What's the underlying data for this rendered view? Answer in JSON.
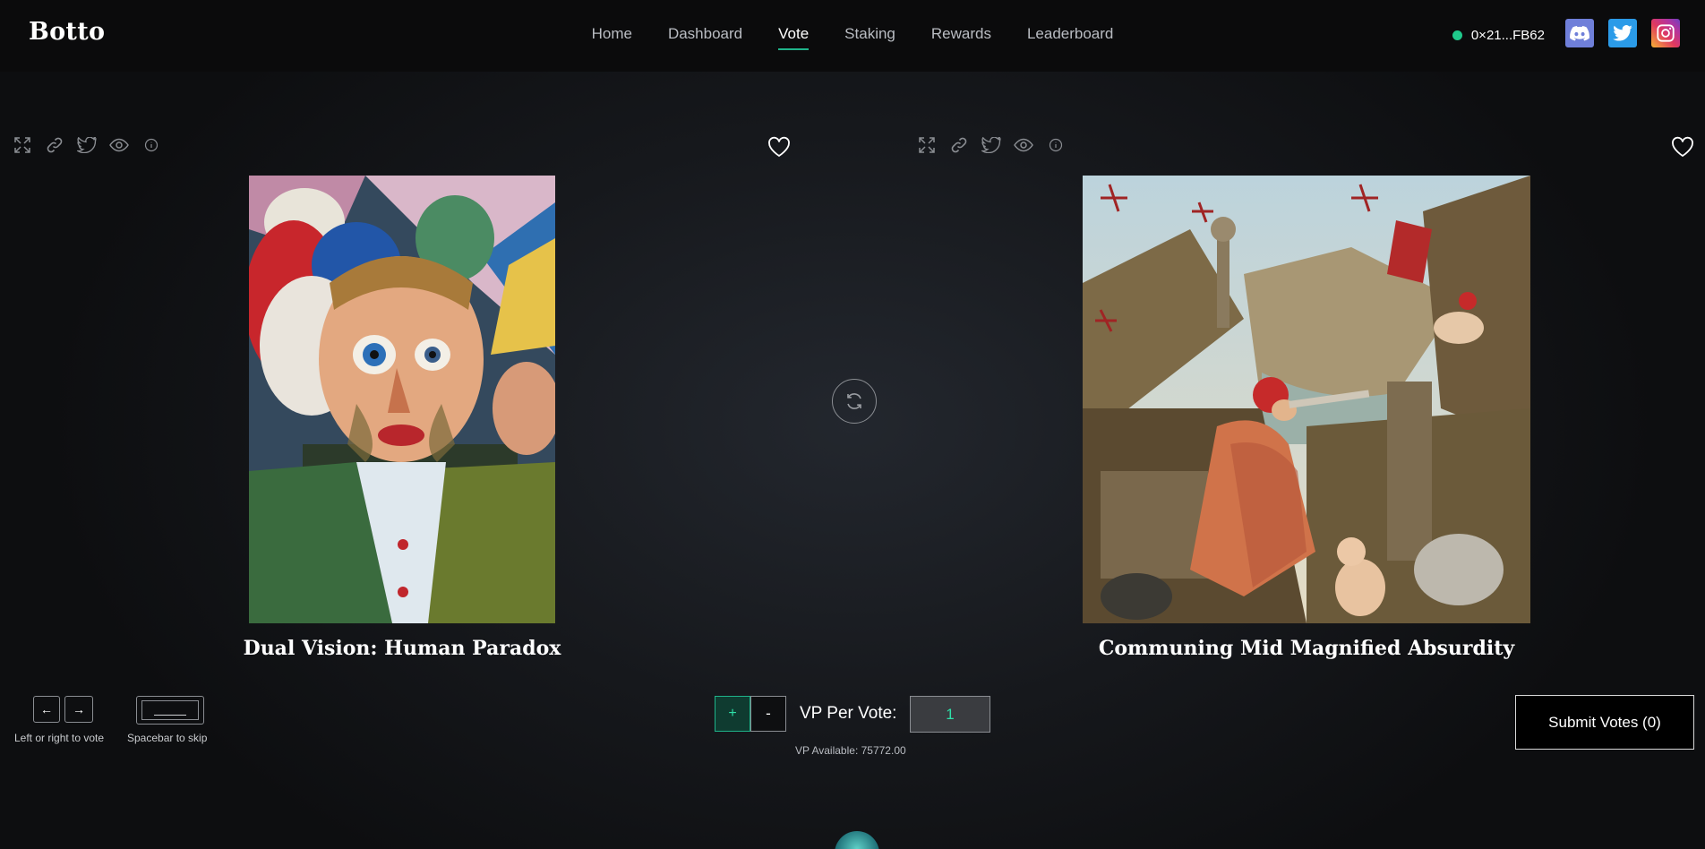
{
  "header": {
    "logo": "Botto",
    "nav": [
      "Home",
      "Dashboard",
      "Vote",
      "Staking",
      "Rewards",
      "Leaderboard"
    ],
    "active_nav": "Vote",
    "wallet_address": "0×21...FB62",
    "wallet_status_color": "#1fc98b",
    "social": [
      "discord-icon",
      "twitter-icon",
      "instagram-icon"
    ]
  },
  "artworks": {
    "left": {
      "title": "Dual Vision: Human Paradox"
    },
    "right": {
      "title": "Communing Mid Magnified Absurdity"
    }
  },
  "controls": {
    "left_arrow": "←",
    "right_arrow": "→",
    "hint_vote": "Left or right to vote",
    "hint_skip": "Spacebar to skip",
    "plus": "+",
    "minus": "-",
    "vp_label": "VP Per Vote:",
    "vp_value": "1",
    "vp_available": "VP Available: 75772.00",
    "submit_label": "Submit Votes (0)"
  },
  "colors": {
    "accent": "#1fb38a",
    "accent_text": "#2ee0a8"
  }
}
